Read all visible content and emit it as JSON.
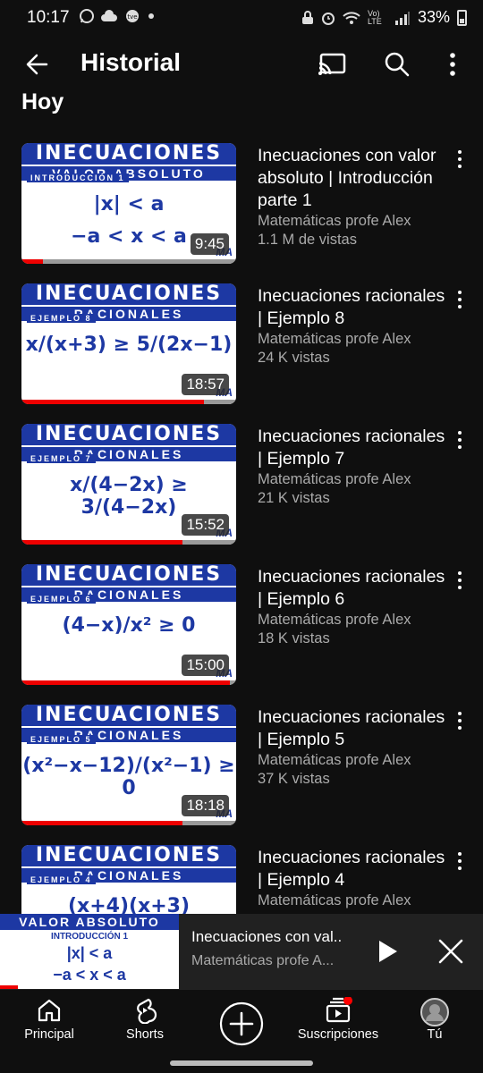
{
  "status_bar": {
    "time": "10:17",
    "battery": "33%",
    "network": "Vo) LTE",
    "left_icons": [
      "whatsapp-icon",
      "cloud-icon",
      "tve-icon",
      "dot-icon"
    ],
    "right_icons": [
      "lock-icon",
      "alarm-icon",
      "wifi-icon",
      "signal-icon",
      "battery-icon"
    ]
  },
  "header": {
    "title": "Historial",
    "icons": [
      "back-arrow-icon",
      "cast-icon",
      "search-icon",
      "more-vert-icon"
    ]
  },
  "section": {
    "label": "Hoy"
  },
  "videos": [
    {
      "title": "Inecuaciones con valor absoluto | Introducción parte 1",
      "channel": "Matemáticas profe Alex",
      "views": "1.1 M de vistas",
      "duration": "9:45",
      "thumb_title": "INECUACIONES",
      "thumb_subtitle": "VALOR ABSOLUTO",
      "thumb_badge": "INTRODUCCIÓN 1",
      "thumb_math": "|x| < a",
      "thumb_math2": "−a < x < a",
      "watched_fraction": 0.1
    },
    {
      "title": "Inecuaciones racionales | Ejemplo 8",
      "channel": "Matemáticas profe Alex",
      "views": "24 K vistas",
      "duration": "18:57",
      "thumb_title": "INECUACIONES",
      "thumb_subtitle": "RACIONALES",
      "thumb_badge": "EJEMPLO 8",
      "thumb_math": "x/(x+3) ≥ 5/(2x−1)",
      "thumb_math2": "",
      "watched_fraction": 0.85
    },
    {
      "title": "Inecuaciones racionales | Ejemplo 7",
      "channel": "Matemáticas profe Alex",
      "views": "21 K vistas",
      "duration": "15:52",
      "thumb_title": "INECUACIONES",
      "thumb_subtitle": "RACIONALES",
      "thumb_badge": "EJEMPLO 7",
      "thumb_math": "x/(4−2x) ≥ 3/(4−2x)",
      "thumb_math2": "",
      "watched_fraction": 0.75
    },
    {
      "title": "Inecuaciones racionales | Ejemplo 6",
      "channel": "Matemáticas profe Alex",
      "views": "18 K vistas",
      "duration": "15:00",
      "thumb_title": "INECUACIONES",
      "thumb_subtitle": "RACIONALES",
      "thumb_badge": "EJEMPLO 6",
      "thumb_math": "(4−x)/x² ≥ 0",
      "thumb_math2": "",
      "watched_fraction": 0.97
    },
    {
      "title": "Inecuaciones racionales | Ejemplo 5",
      "channel": "Matemáticas profe Alex",
      "views": "37 K vistas",
      "duration": "18:18",
      "thumb_title": "INECUACIONES",
      "thumb_subtitle": "RACIONALES",
      "thumb_badge": "EJEMPLO 5",
      "thumb_math": "(x²−x−12)/(x²−1) ≥ 0",
      "thumb_math2": "",
      "watched_fraction": 0.75
    },
    {
      "title": "Inecuaciones racionales | Ejemplo 4",
      "channel": "Matemáticas profe Alex",
      "views": "",
      "duration": "",
      "thumb_title": "INECUACIONES",
      "thumb_subtitle": "RACIONALES",
      "thumb_badge": "EJEMPLO 4",
      "thumb_math": "(x+4)(x+3)",
      "thumb_math2": "",
      "watched_fraction": 0
    }
  ],
  "mini_player": {
    "title": "Inecuaciones con val..",
    "channel": "Matemáticas profe A...",
    "thumb_subtitle": "VALOR ABSOLUTO",
    "thumb_badge": "INTRODUCCIÓN 1",
    "thumb_math": "|x| < a",
    "thumb_math2": "−a < x < a",
    "watched_fraction": 0.1
  },
  "bottom_nav": {
    "home": "Principal",
    "shorts": "Shorts",
    "subscriptions": "Suscripciones",
    "you": "Tú"
  },
  "colors": {
    "background": "#0f0f0f",
    "thumb_blue": "#1d38a3",
    "progress_red": "#e00000",
    "meta_gray": "#aaaaaa"
  }
}
